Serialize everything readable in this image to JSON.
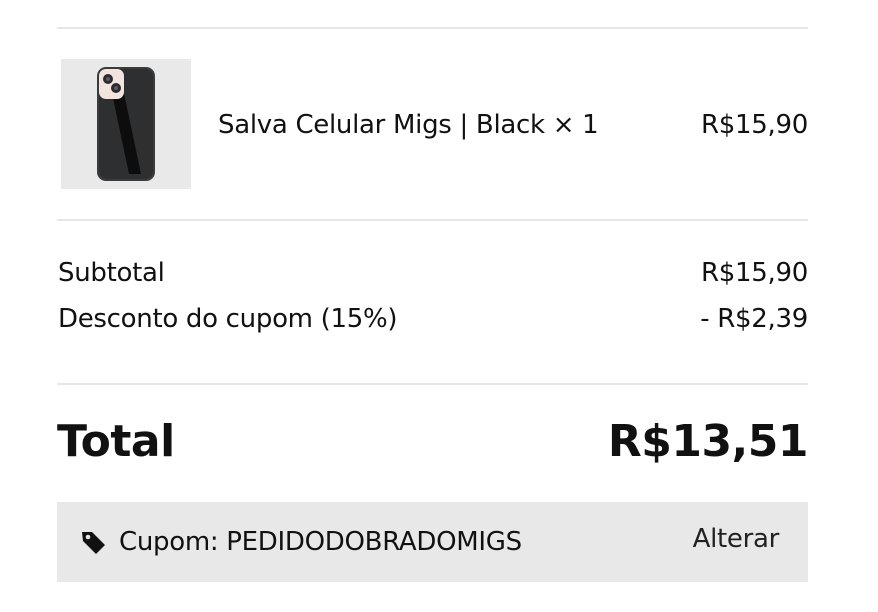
{
  "cart_item": {
    "image_icon": "phone-case-black-image",
    "name": "Salva Celular Migs | Black × 1",
    "price": "R$15,90"
  },
  "summary": {
    "subtotal_label": "Subtotal",
    "subtotal_value": "R$15,90",
    "discount_label": "Desconto do cupom (15%)",
    "discount_value": "- R$2,39"
  },
  "total": {
    "label": "Total",
    "value": "R$13,51"
  },
  "coupon": {
    "icon": "tag-icon",
    "text": "Cupom: PEDIDODOBRADOMIGS",
    "change_label": "Alterar"
  },
  "colors": {
    "divider": "#e6e6e6",
    "coupon_bg": "#e8e8e8",
    "thumb_bg": "#e9e9ea",
    "text": "#111111"
  }
}
